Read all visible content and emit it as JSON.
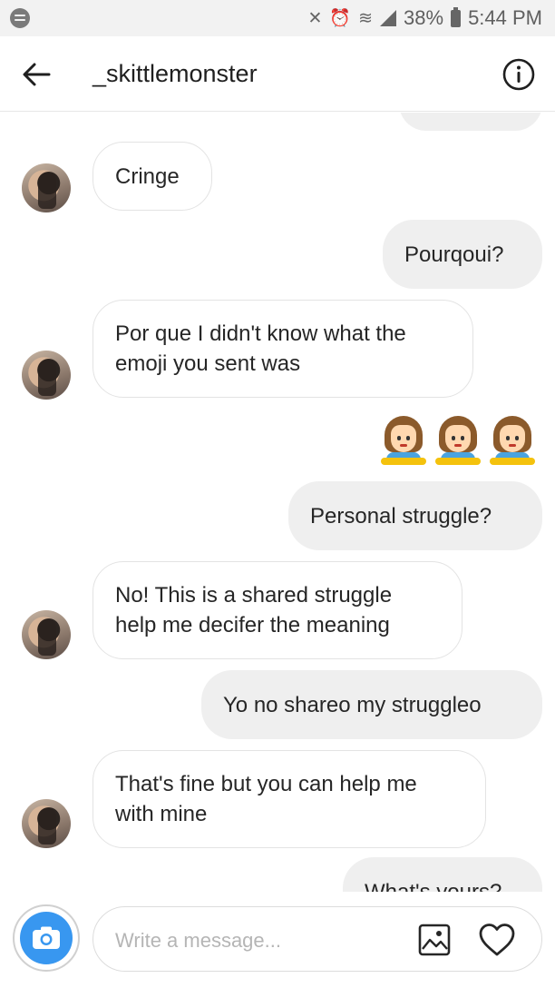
{
  "status_bar": {
    "battery": "38%",
    "time": "5:44 PM",
    "icons": [
      "mute-icon",
      "alarm-icon",
      "wifi-icon",
      "signal-icon",
      "battery-icon"
    ]
  },
  "header": {
    "title": "_skittlemonster",
    "back_icon": "back-arrow-icon",
    "info_icon": "info-icon"
  },
  "messages": [
    {
      "dir": "in",
      "text": "Cringe"
    },
    {
      "dir": "out",
      "text": "Pourqoui?"
    },
    {
      "dir": "in",
      "lines": [
        "Por que I didn't know what the",
        "emoji you sent was"
      ]
    },
    {
      "dir": "out",
      "emoji": [
        "girl-raising-hand-emoji",
        "girl-raising-hand-emoji",
        "girl-raising-hand-emoji"
      ]
    },
    {
      "dir": "out",
      "text": "Personal struggle?"
    },
    {
      "dir": "in",
      "lines": [
        "No! This is a shared struggle",
        "help me decifer the meaning"
      ]
    },
    {
      "dir": "out",
      "text": "Yo no shareo my struggleo"
    },
    {
      "dir": "in",
      "lines": [
        "That's fine but you can help me",
        "with mine"
      ]
    },
    {
      "dir": "out",
      "text": "What's yours?"
    }
  ],
  "composer": {
    "placeholder": "Write a message...",
    "camera_icon": "camera-icon",
    "gallery_icon": "gallery-icon",
    "heart_icon": "heart-icon"
  },
  "colors": {
    "accent": "#3897f0",
    "outgoing_bubble": "#efefef",
    "incoming_border": "#e3e3e3"
  }
}
